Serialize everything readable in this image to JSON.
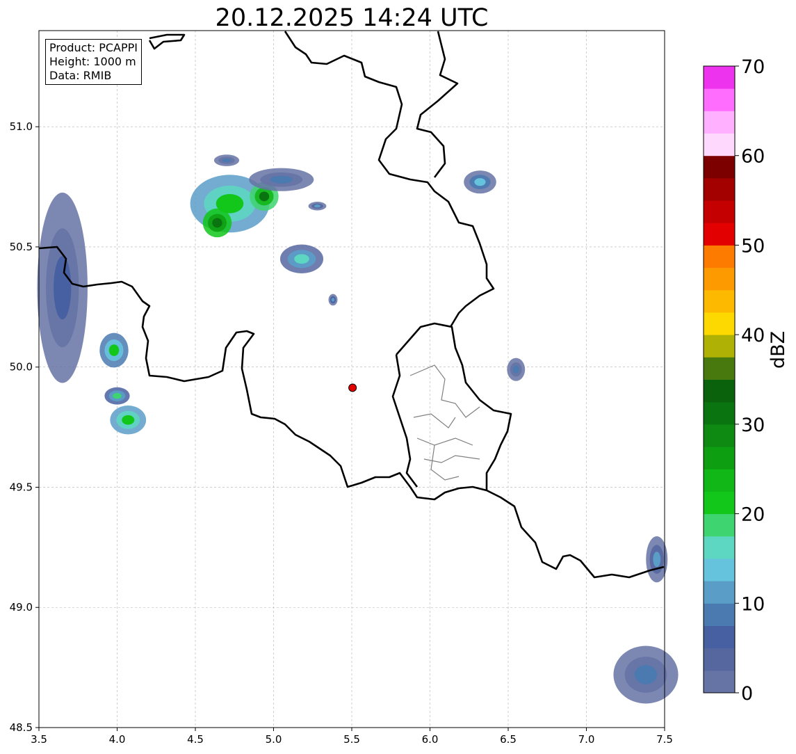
{
  "title": "20.12.2025 14:24 UTC",
  "info": {
    "product": "Product: PCAPPI",
    "height": "Height: 1000 m",
    "source": "Data: RMIB"
  },
  "map": {
    "lon_range": [
      3.5,
      7.5
    ],
    "lat_range": [
      48.5,
      51.4
    ],
    "x_ticks": [
      "3.5",
      "4.0",
      "4.5",
      "5.0",
      "5.5",
      "6.0",
      "6.5",
      "7.0",
      "7.5"
    ],
    "y_ticks": [
      "48.5",
      "49.0",
      "49.5",
      "50.0",
      "50.5",
      "51.0"
    ],
    "grid": true,
    "radar_site": {
      "lon": 5.505,
      "lat": 49.914,
      "color": "#e00000"
    }
  },
  "colorbar": {
    "unit": "dBZ",
    "min": 0,
    "max": 70,
    "step": 2.5,
    "tick_labels": [
      "0",
      "10",
      "20",
      "30",
      "40",
      "50",
      "60",
      "70"
    ],
    "colors": [
      "#6673a5",
      "#5667a0",
      "#4760a1",
      "#4a7ab0",
      "#5a9ec8",
      "#66c3dd",
      "#5dd6c2",
      "#3ed46f",
      "#12c61a",
      "#11b717",
      "#0e9e12",
      "#0e8912",
      "#0a7410",
      "#0b620c",
      "#48790e",
      "#afb104",
      "#fdd801",
      "#fdb900",
      "#fd9a00",
      "#fd7c00",
      "#e30000",
      "#c50000",
      "#a30000",
      "#7d0000",
      "#ffd9fd",
      "#ffb0ff",
      "#ff6dfe",
      "#ee33ef"
    ]
  },
  "echoes": [
    {
      "name": "northwest-cluster",
      "lon": 4.72,
      "lat": 50.68,
      "rx": 0.22,
      "ry": 0.1,
      "dbz": 22
    },
    {
      "name": "northwest-core",
      "lon": 4.64,
      "lat": 50.6,
      "rx": 0.08,
      "ry": 0.05,
      "dbz": 32
    },
    {
      "name": "north-core",
      "lon": 4.94,
      "lat": 50.71,
      "rx": 0.08,
      "ry": 0.05,
      "dbz": 30
    },
    {
      "name": "north-band",
      "lon": 5.05,
      "lat": 50.78,
      "rx": 0.18,
      "ry": 0.04,
      "dbz": 8
    },
    {
      "name": "north-small",
      "lon": 4.7,
      "lat": 50.86,
      "rx": 0.07,
      "ry": 0.02,
      "dbz": 8
    },
    {
      "name": "north-dot",
      "lon": 5.28,
      "lat": 50.67,
      "rx": 0.05,
      "ry": 0.015,
      "dbz": 10
    },
    {
      "name": "center-north",
      "lon": 5.18,
      "lat": 50.45,
      "rx": 0.12,
      "ry": 0.05,
      "dbz": 16
    },
    {
      "name": "center-dot",
      "lon": 5.38,
      "lat": 50.28,
      "rx": 0.025,
      "ry": 0.02,
      "dbz": 12
    },
    {
      "name": "west-band",
      "lon": 3.65,
      "lat": 50.33,
      "rx": 0.14,
      "ry": 0.33,
      "dbz": 6
    },
    {
      "name": "west-cell",
      "lon": 3.98,
      "lat": 50.07,
      "rx": 0.08,
      "ry": 0.06,
      "dbz": 20
    },
    {
      "name": "southwest-cell-a",
      "lon": 4.0,
      "lat": 49.88,
      "rx": 0.07,
      "ry": 0.03,
      "dbz": 18
    },
    {
      "name": "southwest-cell-b",
      "lon": 4.07,
      "lat": 49.78,
      "rx": 0.1,
      "ry": 0.05,
      "dbz": 22
    },
    {
      "name": "east-cell",
      "lon": 6.32,
      "lat": 50.77,
      "rx": 0.09,
      "ry": 0.04,
      "dbz": 14
    },
    {
      "name": "east-small",
      "lon": 6.55,
      "lat": 49.99,
      "rx": 0.05,
      "ry": 0.04,
      "dbz": 8
    },
    {
      "name": "southeast-corner",
      "lon": 7.38,
      "lat": 48.72,
      "rx": 0.18,
      "ry": 0.1,
      "dbz": 8
    },
    {
      "name": "east-edge",
      "lon": 7.45,
      "lat": 49.2,
      "rx": 0.06,
      "ry": 0.08,
      "dbz": 10
    }
  ]
}
